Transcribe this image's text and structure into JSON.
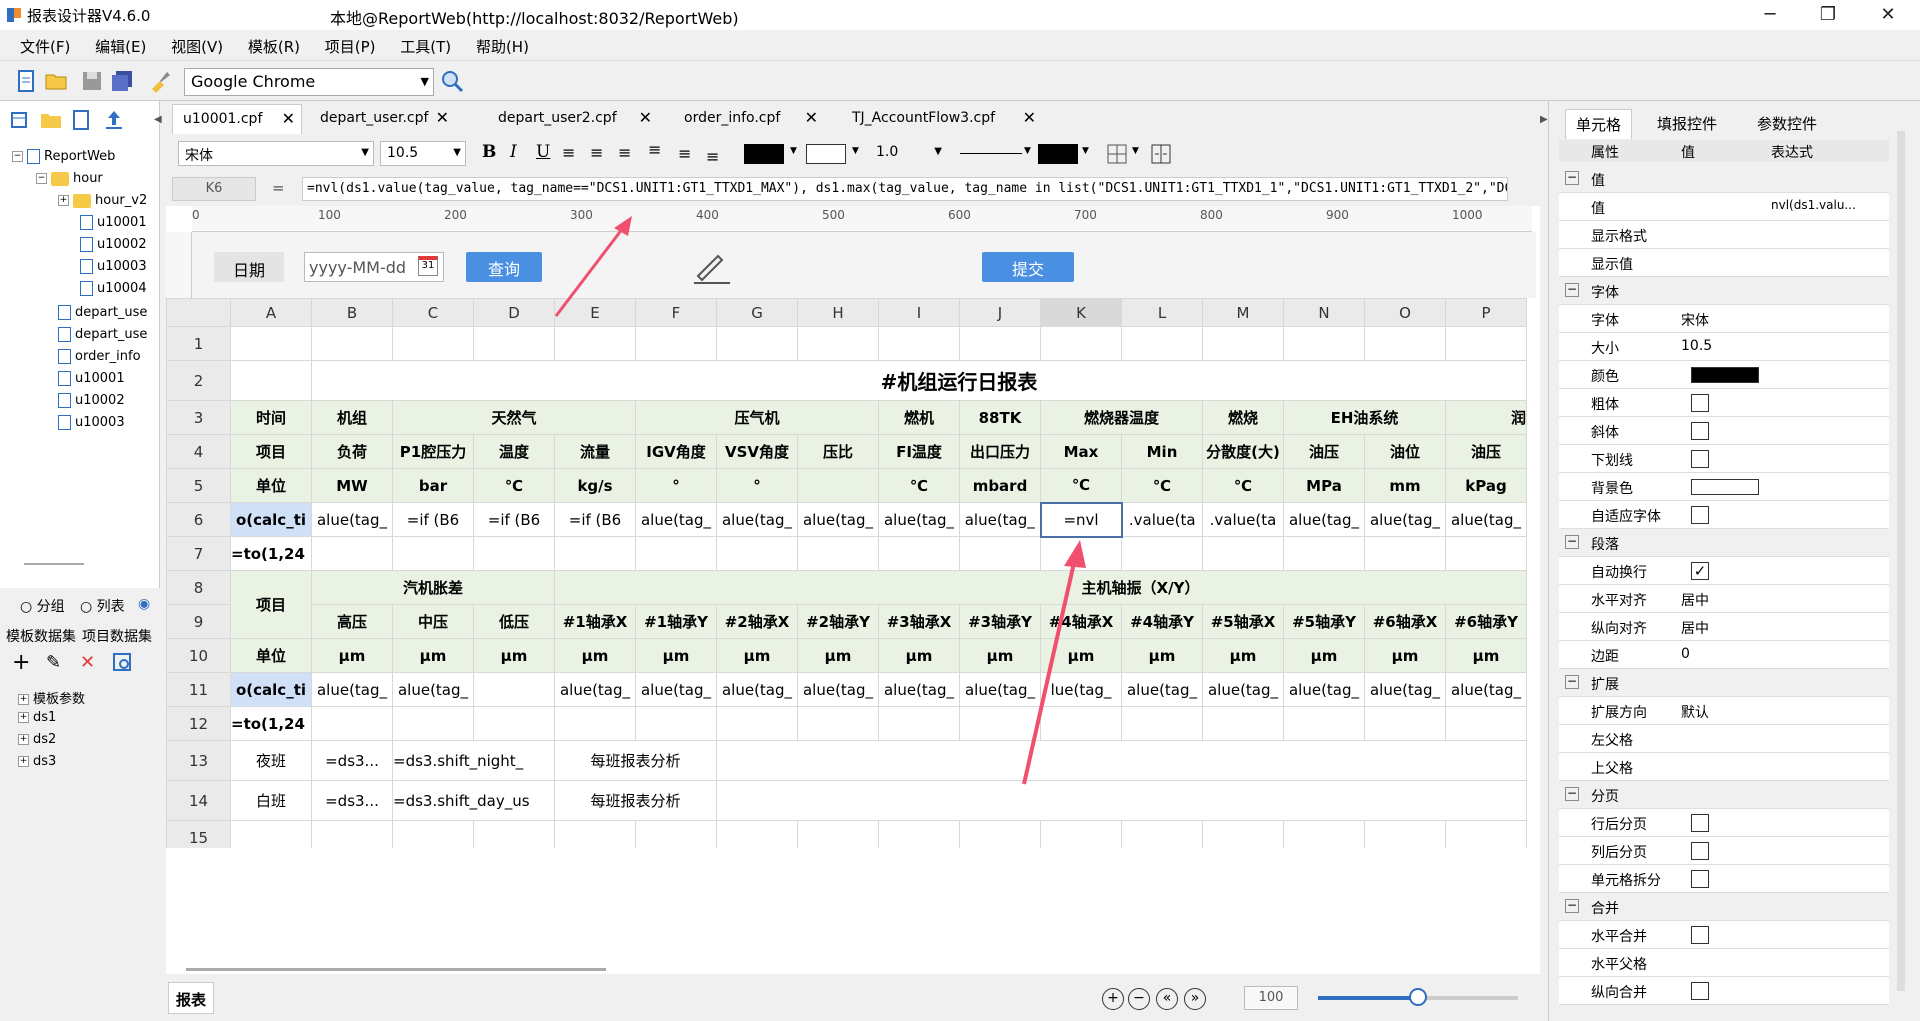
{
  "window": {
    "app_title": "报表设计器V4.6.0",
    "title": "本地@ReportWeb(http://localhost:8032/ReportWeb)",
    "minimize": "─",
    "restore": "❐",
    "close": "✕"
  },
  "menu": [
    "文件(F)",
    "编辑(E)",
    "视图(V)",
    "模板(R)",
    "项目(P)",
    "工具(T)",
    "帮助(H)"
  ],
  "toolbar": {
    "browser": "Google Chrome"
  },
  "tree": {
    "root": "ReportWeb",
    "folder_hour": "hour",
    "folder_hour_v2": "hour_v2",
    "items_hour": [
      "u10001",
      "u10002",
      "u10003",
      "u10004"
    ],
    "items_root": [
      "depart_use",
      "depart_use",
      "order_info",
      "u10001",
      "u10002",
      "u10003"
    ]
  },
  "leftbottom": {
    "radio_group": "分组",
    "radio_list": "列表",
    "ds_tab1": "模板数据集",
    "ds_tab2": "项目数据集",
    "params": "模板参数",
    "datasets": [
      "ds1",
      "ds2",
      "ds3"
    ]
  },
  "tabs": [
    "u10001.cpf",
    "depart_user.cpf",
    "depart_user2.cpf",
    "order_info.cpf",
    "TJ_AccountFlow3.cpf"
  ],
  "format": {
    "font": "宋体",
    "size": "10.5",
    "line": "1.0"
  },
  "formula": {
    "cell": "K6",
    "eq": "=",
    "text": "=nvl(ds1.value(tag_value, tag_name==\"DCS1.UNIT1:GT1_TTXD1_MAX\"), ds1.max(tag_value, tag_name in list(\"DCS1.UNIT1:GT1_TTXD1_1\",\"DCS1.UNIT1:GT1_TTXD1_2\",\"DCS1.UNIT1:G"
  },
  "ruler": [
    "0",
    "100",
    "200",
    "300",
    "400",
    "500",
    "600",
    "700",
    "800",
    "900",
    "1000"
  ],
  "form": {
    "date_label": "日期",
    "date_placeholder": "yyyy-MM-dd",
    "query": "查询",
    "submit": "提交"
  },
  "columns": [
    "A",
    "B",
    "C",
    "D",
    "E",
    "F",
    "G",
    "H",
    "I",
    "J",
    "K",
    "L",
    "M",
    "N",
    "O",
    "P"
  ],
  "rows": [
    "1",
    "2",
    "3",
    "4",
    "5",
    "6",
    "7",
    "8",
    "9",
    "10",
    "11",
    "12",
    "13",
    "14",
    "15"
  ],
  "sheet": {
    "title": "#机组运行日报表",
    "r3": [
      "时间",
      "机组",
      "天然气",
      "压气机",
      "燃机",
      "88TK",
      "燃烧器温度",
      "燃烧",
      "EH油系统",
      "润"
    ],
    "r4": [
      "项目",
      "负荷",
      "P1腔压力",
      "温度",
      "流量",
      "IGV角度",
      "VSV角度",
      "压比",
      "FI温度",
      "出口压力",
      "Max",
      "Min",
      "分散度(大)",
      "油压",
      "油位",
      "油压"
    ],
    "r5": [
      "单位",
      "MW",
      "bar",
      "℃",
      "kg/s",
      "°",
      "°",
      "",
      "℃",
      "mbard",
      "℃",
      "℃",
      "℃",
      "MPa",
      "mm",
      "kPag"
    ],
    "r6": [
      "o(calc_ti",
      "alue(tag_",
      "=if (B6",
      "=if (B6",
      "=if (B6",
      "alue(tag_",
      "alue(tag_",
      "alue(tag_",
      "alue(tag_",
      "alue(tag_",
      "=nvl",
      ".value(ta",
      ".value(ta",
      "alue(tag_",
      "alue(tag_",
      "alue(tag_"
    ],
    "r7a": "=to(1,24",
    "r8": [
      "项目",
      "汽机胀差",
      "主机轴振（X/Y）"
    ],
    "r9": [
      "高压",
      "中压",
      "低压",
      "#1轴承X",
      "#1轴承Y",
      "#2轴承X",
      "#2轴承Y",
      "#3轴承X",
      "#3轴承Y",
      "#4轴承X",
      "#4轴承Y",
      "#5轴承X",
      "#5轴承Y",
      "#6轴承X",
      "#6轴承Y"
    ],
    "r10": [
      "单位",
      "μm",
      "μm",
      "μm",
      "μm",
      "μm",
      "μm",
      "μm",
      "μm",
      "μm",
      "μm",
      "μm",
      "μm",
      "μm",
      "μm",
      "μm"
    ],
    "r11": [
      "o(calc_ti",
      "alue(tag_",
      "alue(tag_",
      "",
      "alue(tag_",
      "alue(tag_",
      "alue(tag_",
      "alue(tag_",
      "alue(tag_",
      "alue(tag_",
      "lue(tag_",
      "alue(tag_",
      "alue(tag_",
      "alue(tag_",
      "alue(tag_",
      "alue(tag_"
    ],
    "r12a": "=to(1,24",
    "r13": [
      "夜班",
      "=ds3...",
      "=ds3.shift_night_",
      "每班报表分析"
    ],
    "r14": [
      "白班",
      "=ds3...",
      "=ds3.shift_day_us",
      "每班报表分析"
    ],
    "r5_unit_h": "压比"
  },
  "bottom": {
    "sheet_tab": "报表",
    "zoom": "100",
    "zoom_level": 0.5
  },
  "right": {
    "tabs": [
      "单元格",
      "填报控件",
      "参数控件"
    ],
    "headers": [
      "属性",
      "值",
      "表达式"
    ],
    "rows": [
      {
        "k": "值",
        "group": true
      },
      {
        "k": "值",
        "v": "",
        "e": "nvl(ds1.valu..."
      },
      {
        "k": "显示格式",
        "v": ""
      },
      {
        "k": "显示值",
        "v": ""
      },
      {
        "k": "字体",
        "group": true
      },
      {
        "k": "字体",
        "v": "宋体"
      },
      {
        "k": "大小",
        "v": "10.5"
      },
      {
        "k": "颜色",
        "swatch": "#000000"
      },
      {
        "k": "粗体",
        "cb": false
      },
      {
        "k": "斜体",
        "cb": false
      },
      {
        "k": "下划线",
        "cb": false
      },
      {
        "k": "背景色",
        "swatch": "#ffffff"
      },
      {
        "k": "自适应字体",
        "cb": false
      },
      {
        "k": "段落",
        "group": true
      },
      {
        "k": "自动换行",
        "cb": true
      },
      {
        "k": "水平对齐",
        "v": "居中"
      },
      {
        "k": "纵向对齐",
        "v": "居中"
      },
      {
        "k": "边距",
        "v": "0"
      },
      {
        "k": "扩展",
        "group": true
      },
      {
        "k": "扩展方向",
        "v": "默认"
      },
      {
        "k": "左父格",
        "v": ""
      },
      {
        "k": "上父格",
        "v": ""
      },
      {
        "k": "分页",
        "group": true
      },
      {
        "k": "行后分页",
        "cb": false
      },
      {
        "k": "列后分页",
        "cb": false
      },
      {
        "k": "单元格拆分",
        "cb": false
      },
      {
        "k": "合并",
        "group": true
      },
      {
        "k": "水平合并",
        "cb": false
      },
      {
        "k": "水平父格",
        "v": ""
      },
      {
        "k": "纵向合并",
        "cb": false
      }
    ]
  },
  "colors": {
    "accent": "#4a90e2",
    "green_cell": "#eaf3e3",
    "arrow": "#f0506e"
  }
}
